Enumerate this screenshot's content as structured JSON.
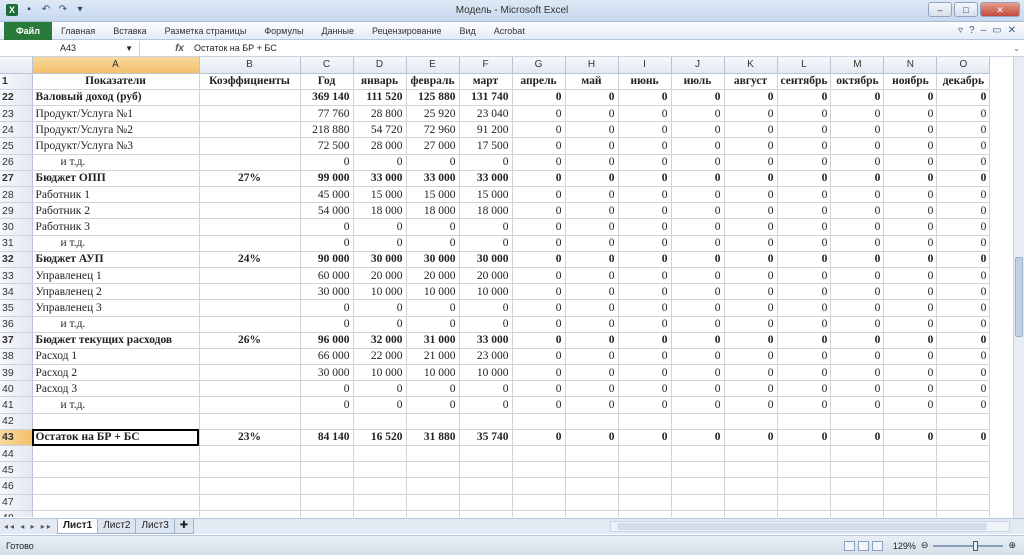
{
  "window": {
    "title": "Модель - Microsoft Excel"
  },
  "ribbon": {
    "file_tab": "Файл",
    "tabs": [
      "Главная",
      "Вставка",
      "Разметка страницы",
      "Формулы",
      "Данные",
      "Рецензирование",
      "Вид",
      "Acrobat"
    ]
  },
  "formula_bar": {
    "name_box": "A43",
    "fx": "fx",
    "content": "Остаток на БР + БС"
  },
  "columns": [
    "A",
    "B",
    "C",
    "D",
    "E",
    "F",
    "G",
    "H",
    "I",
    "J",
    "K",
    "L",
    "M",
    "N",
    "O"
  ],
  "rows": [
    {
      "n": "1",
      "style": "hdr",
      "cells": [
        "Показатели",
        "Коэффициенты",
        "Год",
        "январь",
        "февраль",
        "март",
        "апрель",
        "май",
        "июнь",
        "июль",
        "август",
        "сентябрь",
        "октябрь",
        "ноябрь",
        "декабрь"
      ]
    },
    {
      "n": "22",
      "style": "bold",
      "cells": [
        "Валовый доход (руб)",
        "",
        "369 140",
        "111 520",
        "125 880",
        "131 740",
        "0",
        "0",
        "0",
        "0",
        "0",
        "0",
        "0",
        "0",
        "0"
      ]
    },
    {
      "n": "23",
      "style": "",
      "cells": [
        "Продукт/Услуга №1",
        "",
        "77 760",
        "28 800",
        "25 920",
        "23 040",
        "0",
        "0",
        "0",
        "0",
        "0",
        "0",
        "0",
        "0",
        "0"
      ]
    },
    {
      "n": "24",
      "style": "",
      "cells": [
        "Продукт/Услуга №2",
        "",
        "218 880",
        "54 720",
        "72 960",
        "91 200",
        "0",
        "0",
        "0",
        "0",
        "0",
        "0",
        "0",
        "0",
        "0"
      ]
    },
    {
      "n": "25",
      "style": "",
      "cells": [
        "Продукт/Услуга №3",
        "",
        "72 500",
        "28 000",
        "27 000",
        "17 500",
        "0",
        "0",
        "0",
        "0",
        "0",
        "0",
        "0",
        "0",
        "0"
      ]
    },
    {
      "n": "26",
      "style": "ind",
      "cells": [
        "и т.д.",
        "",
        "0",
        "0",
        "0",
        "0",
        "0",
        "0",
        "0",
        "0",
        "0",
        "0",
        "0",
        "0",
        "0"
      ]
    },
    {
      "n": "27",
      "style": "bold",
      "cells": [
        "Бюджет ОПП",
        "27%",
        "99 000",
        "33 000",
        "33 000",
        "33 000",
        "0",
        "0",
        "0",
        "0",
        "0",
        "0",
        "0",
        "0",
        "0"
      ]
    },
    {
      "n": "28",
      "style": "",
      "cells": [
        "Работник 1",
        "",
        "45 000",
        "15 000",
        "15 000",
        "15 000",
        "0",
        "0",
        "0",
        "0",
        "0",
        "0",
        "0",
        "0",
        "0"
      ]
    },
    {
      "n": "29",
      "style": "",
      "cells": [
        "Работник 2",
        "",
        "54 000",
        "18 000",
        "18 000",
        "18 000",
        "0",
        "0",
        "0",
        "0",
        "0",
        "0",
        "0",
        "0",
        "0"
      ]
    },
    {
      "n": "30",
      "style": "",
      "cells": [
        "Работник 3",
        "",
        "0",
        "0",
        "0",
        "0",
        "0",
        "0",
        "0",
        "0",
        "0",
        "0",
        "0",
        "0",
        "0"
      ]
    },
    {
      "n": "31",
      "style": "ind",
      "cells": [
        "и т.д.",
        "",
        "0",
        "0",
        "0",
        "0",
        "0",
        "0",
        "0",
        "0",
        "0",
        "0",
        "0",
        "0",
        "0"
      ]
    },
    {
      "n": "32",
      "style": "bold",
      "cells": [
        "Бюджет АУП",
        "24%",
        "90 000",
        "30 000",
        "30 000",
        "30 000",
        "0",
        "0",
        "0",
        "0",
        "0",
        "0",
        "0",
        "0",
        "0"
      ]
    },
    {
      "n": "33",
      "style": "",
      "cells": [
        "Управленец 1",
        "",
        "60 000",
        "20 000",
        "20 000",
        "20 000",
        "0",
        "0",
        "0",
        "0",
        "0",
        "0",
        "0",
        "0",
        "0"
      ]
    },
    {
      "n": "34",
      "style": "",
      "cells": [
        "Управленец 2",
        "",
        "30 000",
        "10 000",
        "10 000",
        "10 000",
        "0",
        "0",
        "0",
        "0",
        "0",
        "0",
        "0",
        "0",
        "0"
      ]
    },
    {
      "n": "35",
      "style": "",
      "cells": [
        "Управленец 3",
        "",
        "0",
        "0",
        "0",
        "0",
        "0",
        "0",
        "0",
        "0",
        "0",
        "0",
        "0",
        "0",
        "0"
      ]
    },
    {
      "n": "36",
      "style": "ind",
      "cells": [
        "и т.д.",
        "",
        "0",
        "0",
        "0",
        "0",
        "0",
        "0",
        "0",
        "0",
        "0",
        "0",
        "0",
        "0",
        "0"
      ]
    },
    {
      "n": "37",
      "style": "bold",
      "cells": [
        "Бюджет текущих расходов",
        "26%",
        "96 000",
        "32 000",
        "31 000",
        "33 000",
        "0",
        "0",
        "0",
        "0",
        "0",
        "0",
        "0",
        "0",
        "0"
      ]
    },
    {
      "n": "38",
      "style": "",
      "cells": [
        "Расход 1",
        "",
        "66 000",
        "22 000",
        "21 000",
        "23 000",
        "0",
        "0",
        "0",
        "0",
        "0",
        "0",
        "0",
        "0",
        "0"
      ]
    },
    {
      "n": "39",
      "style": "",
      "cells": [
        "Расход 2",
        "",
        "30 000",
        "10 000",
        "10 000",
        "10 000",
        "0",
        "0",
        "0",
        "0",
        "0",
        "0",
        "0",
        "0",
        "0"
      ]
    },
    {
      "n": "40",
      "style": "",
      "cells": [
        "Расход 3",
        "",
        "0",
        "0",
        "0",
        "0",
        "0",
        "0",
        "0",
        "0",
        "0",
        "0",
        "0",
        "0",
        "0"
      ]
    },
    {
      "n": "41",
      "style": "ind",
      "cells": [
        "и т.д.",
        "",
        "0",
        "0",
        "0",
        "0",
        "0",
        "0",
        "0",
        "0",
        "0",
        "0",
        "0",
        "0",
        "0"
      ]
    },
    {
      "n": "42",
      "style": "",
      "cells": [
        "",
        "",
        "",
        "",
        "",
        "",
        "",
        "",
        "",
        "",
        "",
        "",
        "",
        "",
        ""
      ]
    },
    {
      "n": "43",
      "style": "bold",
      "cells": [
        "Остаток на БР + БС",
        "23%",
        "84 140",
        "16 520",
        "31 880",
        "35 740",
        "0",
        "0",
        "0",
        "0",
        "0",
        "0",
        "0",
        "0",
        "0"
      ]
    },
    {
      "n": "44",
      "style": "",
      "cells": [
        "",
        "",
        "",
        "",
        "",
        "",
        "",
        "",
        "",
        "",
        "",
        "",
        "",
        "",
        ""
      ]
    },
    {
      "n": "45",
      "style": "",
      "cells": [
        "",
        "",
        "",
        "",
        "",
        "",
        "",
        "",
        "",
        "",
        "",
        "",
        "",
        "",
        ""
      ]
    },
    {
      "n": "46",
      "style": "",
      "cells": [
        "",
        "",
        "",
        "",
        "",
        "",
        "",
        "",
        "",
        "",
        "",
        "",
        "",
        "",
        ""
      ]
    },
    {
      "n": "47",
      "style": "",
      "cells": [
        "",
        "",
        "",
        "",
        "",
        "",
        "",
        "",
        "",
        "",
        "",
        "",
        "",
        "",
        ""
      ]
    },
    {
      "n": "48",
      "style": "",
      "cells": [
        "",
        "",
        "",
        "",
        "",
        "",
        "",
        "",
        "",
        "",
        "",
        "",
        "",
        "",
        ""
      ]
    }
  ],
  "sheets": [
    "Лист1",
    "Лист2",
    "Лист3"
  ],
  "status": {
    "ready": "Готово",
    "zoom": "129%"
  }
}
